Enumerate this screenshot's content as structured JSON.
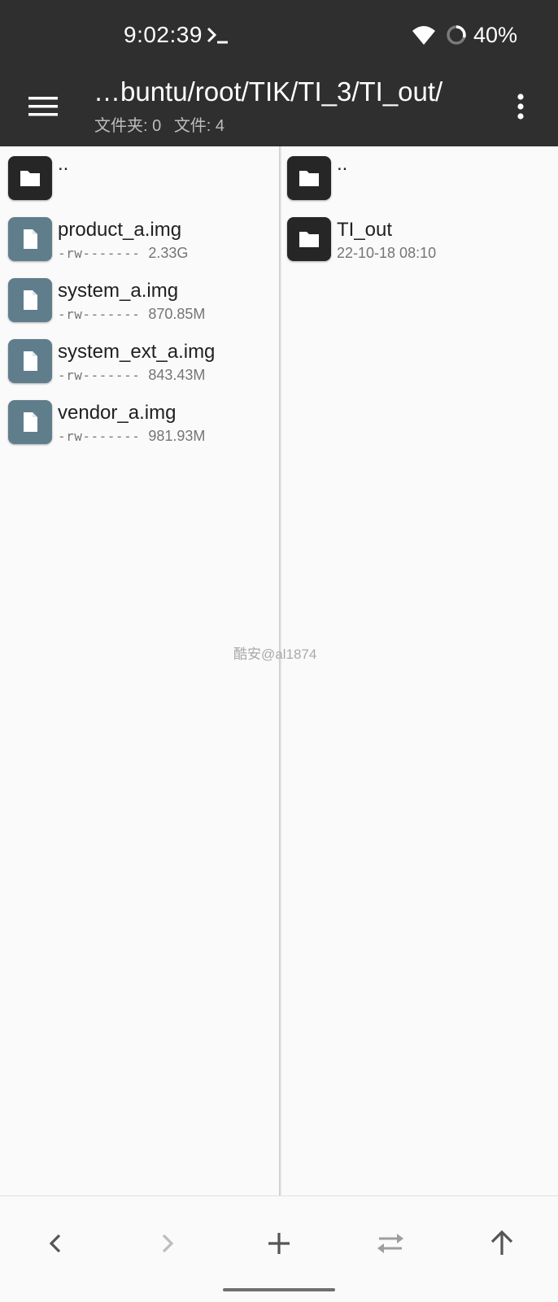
{
  "status": {
    "time": "9:02:39",
    "battery": "40%",
    "icons": [
      "terminal-icon",
      "wifi-icon",
      "battery-icon"
    ]
  },
  "appbar": {
    "path": "…buntu/root/TIK/TI_3/TI_out/",
    "folders_label": "文件夹: 0",
    "files_label": "文件: 4",
    "icons": [
      "menu-icon",
      "more-vert-icon"
    ]
  },
  "left_pane": {
    "parent": {
      "name": ".."
    },
    "files": [
      {
        "name": "product_a.img",
        "perm": "-rw-------",
        "size": "2.33G"
      },
      {
        "name": "system_a.img",
        "perm": "-rw-------",
        "size": "870.85M"
      },
      {
        "name": "system_ext_a.img",
        "perm": "-rw-------",
        "size": "843.43M"
      },
      {
        "name": "vendor_a.img",
        "perm": "-rw-------",
        "size": "981.93M"
      }
    ]
  },
  "right_pane": {
    "parent": {
      "name": ".."
    },
    "folders": [
      {
        "name": "TI_out",
        "date": "22-10-18 08:10"
      }
    ]
  },
  "watermark": "酷安@al1874",
  "bottom_nav": {
    "icons": [
      "back-icon",
      "forward-icon",
      "add-icon",
      "swap-icon",
      "up-icon"
    ]
  },
  "colors": {
    "bar": "#2f2f2f",
    "folder_icon_bg": "#262626",
    "file_icon_bg": "#607d8b",
    "background": "#fafafa"
  }
}
